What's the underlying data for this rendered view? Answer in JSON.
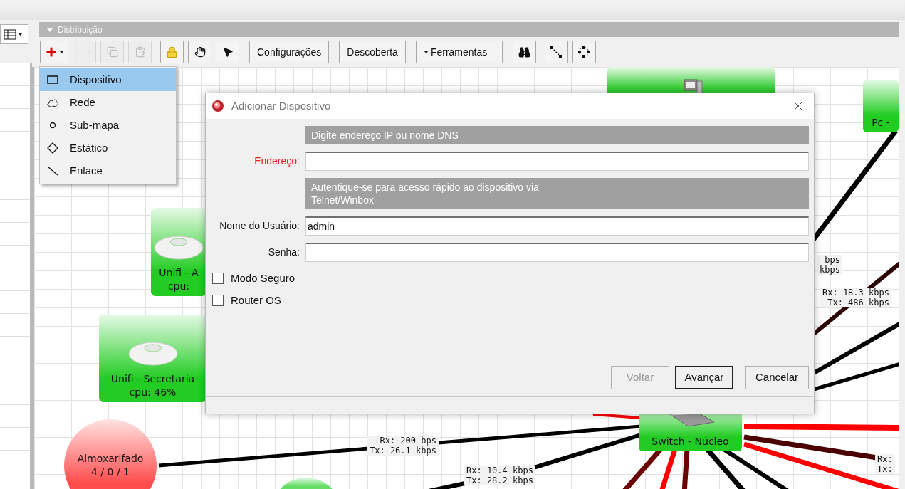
{
  "panel": {
    "title": "Distribuição"
  },
  "toolbar": {
    "icon_buttons": [
      {
        "disabled": false
      },
      {
        "disabled": true
      },
      {
        "disabled": true
      },
      {
        "disabled": true
      },
      {
        "disabled": false
      },
      {
        "disabled": false
      },
      {
        "disabled": false
      }
    ],
    "buttons": [
      {
        "label": "Configurações",
        "dropdown": false
      },
      {
        "label": "Descoberta",
        "dropdown": false
      },
      {
        "label": "Ferramentas",
        "dropdown": true
      }
    ],
    "tool_buttons": [
      {
        "disabled": false
      },
      {
        "disabled": false
      },
      {
        "disabled": false
      }
    ]
  },
  "add_menu": [
    {
      "label": "Dispositivo",
      "selected": true
    },
    {
      "label": "Rede",
      "selected": false
    },
    {
      "label": "Sub-mapa",
      "selected": false
    },
    {
      "label": "Estático",
      "selected": false
    },
    {
      "label": "Enlace",
      "selected": false
    }
  ],
  "map": {
    "nodes": [
      {
        "kind": "box",
        "color": "#33cc33"
      },
      {
        "kind": "box",
        "color": "#22cc22",
        "lines": [
          "Pc -"
        ]
      },
      {
        "kind": "box",
        "color": "#22cc22",
        "lines": [
          "Unifi - A",
          "cpu:"
        ]
      },
      {
        "kind": "box",
        "color": "#22cc22",
        "lines": [
          "Unifi - Secretaria",
          "cpu: 46%"
        ]
      },
      {
        "kind": "circle",
        "color": "#ff4d4d",
        "lines": [
          "Almoxarifado",
          "4 / 0 / 1"
        ]
      },
      {
        "kind": "box",
        "color": "#22cc22",
        "lines": [
          "Switch - Núcleo"
        ]
      },
      {
        "kind": "circle",
        "color": "#66dd66"
      }
    ],
    "links": [
      {
        "color": "#000000"
      },
      {
        "color": "#000000"
      },
      {
        "color": "#2a0000"
      },
      {
        "color": "#000000"
      },
      {
        "color": "#000000"
      },
      {
        "color": "#ff0000"
      },
      {
        "color": "#4a0000"
      },
      {
        "color": "#ff0000"
      },
      {
        "color": "#000000"
      },
      {
        "color": "#000000"
      },
      {
        "color": "#6a0000"
      },
      {
        "color": "#ff0000"
      },
      {
        "color": "#6a0000"
      },
      {
        "color": "#000000"
      },
      {
        "color": "#000000"
      },
      {
        "color": "#ff0000"
      }
    ],
    "traffic_labels": [
      {
        "lines": [
          "bps",
          "kbps"
        ]
      },
      {
        "lines": [
          "Rx: 18.3 kbps",
          "Tx: 486 kbps"
        ]
      },
      {
        "lines": [
          "Rx: 200 bps",
          "Tx: 26.1 kbps"
        ]
      },
      {
        "lines": [
          "Rx: 10.4 kbps",
          "Tx: 28.2 kbps"
        ]
      },
      {
        "lines": [
          "Rx:",
          "Tx:"
        ]
      }
    ]
  },
  "dialog": {
    "title": "Adicionar Dispositivo",
    "rows": [
      {
        "kind": "header",
        "lines": [
          "Digite endereço IP ou nome DNS"
        ]
      },
      {
        "kind": "field",
        "label": "Endereço:",
        "required": true
      },
      {
        "kind": "header",
        "lines": [
          "Autentique-se para acesso rápido ao dispositivo via",
          "Telnet/Winbox"
        ]
      },
      {
        "kind": "field",
        "label": "Nome do Usuário:",
        "required": false,
        "value": "admin"
      },
      {
        "kind": "field",
        "label": "Senha:",
        "required": false
      }
    ],
    "checkboxes": [
      {
        "label": "Modo Seguro",
        "checked": false
      },
      {
        "label": "Router OS",
        "checked": false
      }
    ],
    "buttons": [
      {
        "label": "Voltar",
        "disabled": true,
        "default": false
      },
      {
        "label": "Avançar",
        "disabled": false,
        "default": true
      },
      {
        "label": "Cancelar",
        "disabled": false,
        "default": false
      }
    ]
  }
}
